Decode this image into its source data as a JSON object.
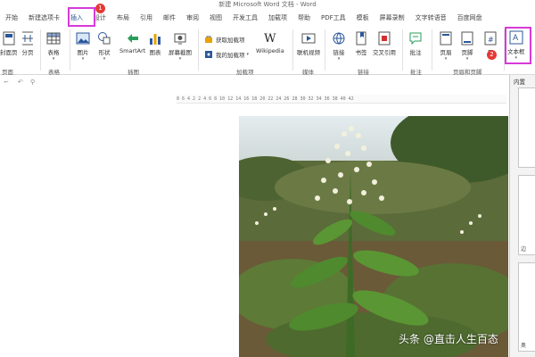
{
  "window": {
    "title": "新建 Microsoft Word 文档 - Word"
  },
  "tabs": [
    {
      "label": "开始",
      "active": false
    },
    {
      "label": "新建选项卡",
      "active": false
    },
    {
      "label": "插入",
      "active": true
    },
    {
      "label": "设计",
      "active": false
    },
    {
      "label": "布局",
      "active": false
    },
    {
      "label": "引用",
      "active": false
    },
    {
      "label": "邮件",
      "active": false
    },
    {
      "label": "审阅",
      "active": false
    },
    {
      "label": "视图",
      "active": false
    },
    {
      "label": "开发工具",
      "active": false
    },
    {
      "label": "加载项",
      "active": false
    },
    {
      "label": "帮助",
      "active": false
    },
    {
      "label": "PDF工具",
      "active": false
    },
    {
      "label": "模板",
      "active": false
    },
    {
      "label": "屏幕录制",
      "active": false
    },
    {
      "label": "文字转语音",
      "active": false
    },
    {
      "label": "百度网盘",
      "active": false
    }
  ],
  "steps": {
    "step1": "1",
    "step2": "2"
  },
  "ribbon": {
    "pages": {
      "cover": "封面页",
      "blank": "分页",
      "group": "页面"
    },
    "tables": {
      "table": "表格",
      "group": "表格"
    },
    "illustrations": {
      "picture": "图片",
      "shapes": "形状",
      "smartart": "SmartArt",
      "chart": "图表",
      "screenshot": "屏幕截图",
      "group": "插图"
    },
    "addins": {
      "get": "获取加载项",
      "my": "我的加载项",
      "wikipedia": "Wikipedia",
      "wiki_glyph": "W",
      "group": "加载项"
    },
    "media": {
      "online_video": "联机视频",
      "group": "媒体"
    },
    "links": {
      "link": "链接",
      "bookmark": "书签",
      "crossref": "交叉引用",
      "group": "链接"
    },
    "comments": {
      "comment": "批注",
      "group": "批注"
    },
    "header_footer": {
      "header": "页眉",
      "footer": "页脚",
      "page_number": "页",
      "group": "页眉和页脚"
    },
    "text": {
      "textbox": "文本框"
    }
  },
  "gallery": {
    "label": "内置",
    "side_labels": [
      "边",
      "奥"
    ]
  },
  "ruler": {
    "marks": "8   6   4   2       2   4   6   8  10  12  14  16  18  20  22  24  26  28  30  32  34  36  38  40  42"
  },
  "watermark": "头条 @直击人生百态",
  "colors": {
    "highlight": "#d63ad9",
    "accent": "#2b579a",
    "badge": "#e53935"
  }
}
